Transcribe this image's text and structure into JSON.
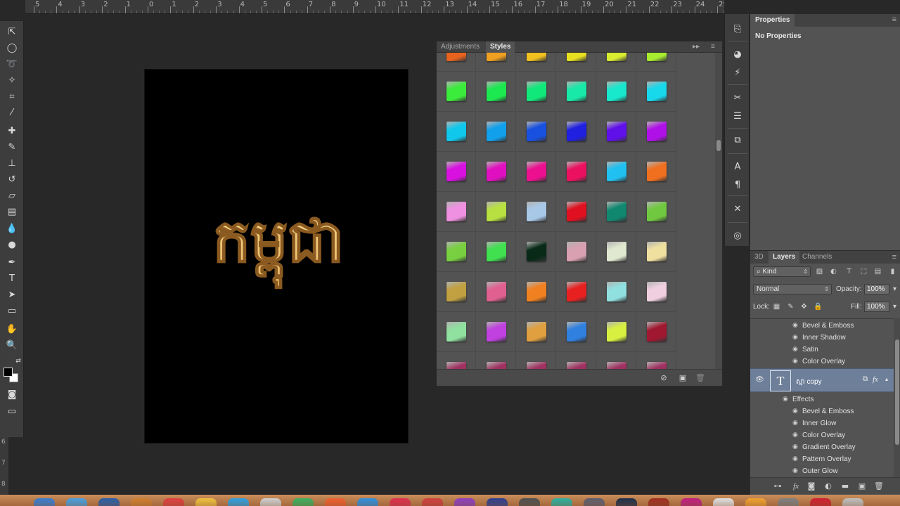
{
  "ruler": {
    "numbers": [
      "5",
      "4",
      "3",
      "2",
      "1",
      "0",
      "1",
      "2",
      "3",
      "4",
      "5",
      "6",
      "7",
      "8",
      "9",
      "10",
      "11",
      "12",
      "13",
      "14",
      "15",
      "16",
      "17",
      "18",
      "19",
      "20",
      "21",
      "22",
      "23",
      "24",
      "25"
    ],
    "left_numbers": [
      "6",
      "7",
      "8"
    ]
  },
  "tools": [
    {
      "name": "move-tool-icon",
      "glyph": "move"
    },
    {
      "name": "elliptical-marquee-tool-icon",
      "glyph": "marquee"
    },
    {
      "name": "lasso-tool-icon",
      "glyph": "lasso"
    },
    {
      "name": "magic-wand-tool-icon",
      "glyph": "wand"
    },
    {
      "name": "crop-tool-icon",
      "glyph": "crop"
    },
    {
      "name": "eyedropper-tool-icon",
      "glyph": "eyedropper"
    },
    {
      "name": "spot-healing-brush-icon",
      "glyph": "healing"
    },
    {
      "name": "brush-tool-icon",
      "glyph": "brush"
    },
    {
      "name": "clone-stamp-tool-icon",
      "glyph": "stamp"
    },
    {
      "name": "history-brush-icon",
      "glyph": "history"
    },
    {
      "name": "eraser-tool-icon",
      "glyph": "eraser"
    },
    {
      "name": "gradient-tool-icon",
      "glyph": "gradient"
    },
    {
      "name": "blur-tool-icon",
      "glyph": "blur"
    },
    {
      "name": "dodge-tool-icon",
      "glyph": "dodge"
    },
    {
      "name": "pen-tool-icon",
      "glyph": "pen"
    },
    {
      "name": "type-tool-icon",
      "glyph": "T"
    },
    {
      "name": "path-selection-tool-icon",
      "glyph": "path"
    },
    {
      "name": "rectangle-tool-icon",
      "glyph": "rect"
    },
    {
      "name": "hand-tool-icon",
      "glyph": "hand"
    },
    {
      "name": "zoom-tool-icon",
      "glyph": "zoom"
    }
  ],
  "styles_panel": {
    "tabs": [
      "Adjustments",
      "Styles"
    ],
    "active_tab": "Styles",
    "swatches": [
      [
        "#e8641e",
        "#f0a020",
        "#f0c020",
        "#e8e020",
        "#d8ec30",
        "#a8ec30"
      ],
      [
        "#3cec3c",
        "#1ce850",
        "#10e87a",
        "#18e8a8",
        "#18e8cc",
        "#18d8ec"
      ],
      [
        "#10c8ec",
        "#10a0ec",
        "#1850e0",
        "#2020e0",
        "#6010e8",
        "#b010e8"
      ],
      [
        "#d810e0",
        "#e010c0",
        "#ec1090",
        "#ec1060",
        "#20c0f0",
        "#f07020"
      ],
      [
        "#f090e0",
        "#b8e040",
        "#a8c8e8",
        "#e01020",
        "#108870",
        "#70c840"
      ],
      [
        "#78d040",
        "#40e050",
        "#0a2a18",
        "#d8a0b0",
        "#e0e8d0",
        "#f0e0a0"
      ],
      [
        "#c0a040",
        "#e06090",
        "#f08020",
        "#e82020",
        "#90e0e0",
        "#f0d0e0"
      ],
      [
        "#90e0a0",
        "#c040e0",
        "#e0a040",
        "#3080e0",
        "#d8f040",
        "#a01830"
      ]
    ]
  },
  "icon_strip": [
    "history-icon",
    "navigator-icon",
    "styles-icon",
    "brush-presets-icon",
    "adjustments-icon",
    "layer-comps-icon",
    "character-icon",
    "paragraph-icon",
    "tool-presets-icon",
    "libraries-icon"
  ],
  "properties_panel": {
    "tab": "Properties",
    "empty_text": "No Properties"
  },
  "layers_panel": {
    "tabs": [
      "3D",
      "Layers",
      "Channels"
    ],
    "active_tab": "Layers",
    "filter_kind": "Kind",
    "blend_mode": "Normal",
    "opacity_label": "Opacity:",
    "opacity_value": "100%",
    "lock_label": "Lock:",
    "fill_label": "Fill:",
    "fill_value": "100%",
    "effects_above": [
      "Bevel & Emboss",
      "Inner Shadow",
      "Satin",
      "Color Overlay"
    ],
    "selected_layer": {
      "name": "ស្មា copy",
      "thumb_glyph": "T"
    },
    "effects_group_label": "Effects",
    "effects_below": [
      "Bevel & Emboss",
      "Inner Glow",
      "Color Overlay",
      "Gradient Overlay",
      "Pattern Overlay",
      "Outer Glow"
    ]
  },
  "document": {
    "text": "កម្ពុជា",
    "background": "#000000",
    "text_color": "#f2c577"
  },
  "dock_colors": [
    "#3a7fd0",
    "#4aa0e0",
    "#2b5ea8",
    "#d08030",
    "#e04040",
    "#f0c040",
    "#30a0e0",
    "#d0d0d0",
    "#40b060",
    "#f06030",
    "#3090e0",
    "#e03050",
    "#d04040",
    "#9040c0",
    "#304090",
    "#505050",
    "#30b0a0",
    "#606070",
    "#20304a",
    "#a03020",
    "#c02080",
    "#e0e0e0",
    "#f0a030",
    "#808080",
    "#d02030",
    "#c0c0c0"
  ]
}
